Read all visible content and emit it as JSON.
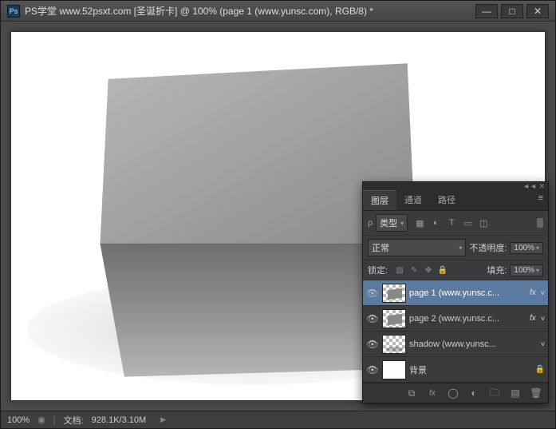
{
  "titlebar": {
    "app_icon": "Ps",
    "title": "PS学堂 www.52psxt.com [圣诞折卡] @ 100% (page 1 (www.yunsc.com), RGB/8) *"
  },
  "statusbar": {
    "zoom": "100%",
    "doc_label": "文档:",
    "doc_value": "928.1K/3.10M"
  },
  "layers": {
    "tabs": {
      "layers": "图层",
      "channels": "通道",
      "paths": "路径"
    },
    "filter_label": "类型",
    "blend_mode": "正常",
    "opacity_label": "不透明度:",
    "opacity_value": "100%",
    "lock_label": "锁定:",
    "fill_label": "填充:",
    "fill_value": "100%",
    "items": [
      {
        "name": "page 1 (www.yunsc.c...",
        "fx": true,
        "selected": true,
        "thumb": "card"
      },
      {
        "name": "page 2 (www.yunsc.c...",
        "fx": true,
        "selected": false,
        "thumb": "card"
      },
      {
        "name": "shadow (www.yunsc...",
        "fx": false,
        "selected": false,
        "thumb": "shadow",
        "chev": true
      },
      {
        "name": "背景",
        "fx": false,
        "selected": false,
        "thumb": "white",
        "locked": true
      }
    ]
  }
}
